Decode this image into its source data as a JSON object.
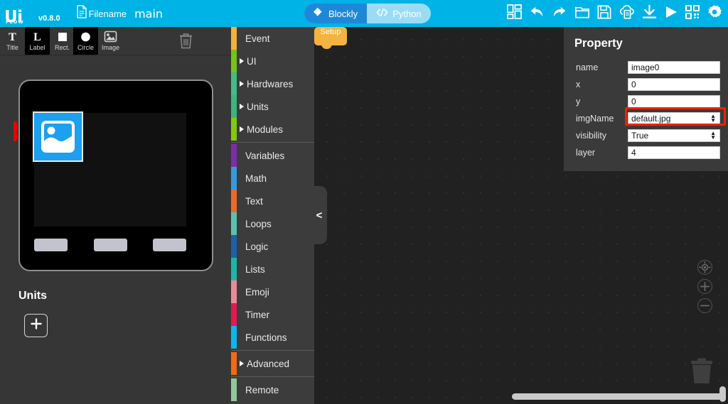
{
  "header": {
    "logo_main": "Ui",
    "logo_sub": "FLOW",
    "version": "v0.8.0",
    "filename_label": "Filename",
    "filename_value": "main",
    "doc_icon": "document-icon",
    "modes": [
      {
        "label": "Blockly",
        "icon": "puzzle-icon",
        "active": true
      },
      {
        "label": "Python",
        "icon": "code-icon",
        "active": false
      }
    ],
    "toolbar_icons": [
      "layout-blocks-icon",
      "undo-icon",
      "redo-icon",
      "open-folder-icon",
      "save-disk-icon",
      "cloud-file-icon",
      "download-icon",
      "run-play-icon",
      "qrcode-icon",
      "settings-gear-icon"
    ],
    "accent_color": "#00b3e6",
    "mode_active_color": "#1e88d8",
    "mode_track_color": "#9bdcf5"
  },
  "tools": {
    "items": [
      {
        "label": "Title",
        "icon": "title-T-icon",
        "selected": false
      },
      {
        "label": "Label",
        "icon": "label-L-icon",
        "selected": true
      },
      {
        "label": "Rect.",
        "icon": "rectangle-icon",
        "selected": false
      },
      {
        "label": "Circle",
        "icon": "circle-icon",
        "selected": true
      },
      {
        "label": "Image",
        "icon": "image-icon",
        "selected": false
      }
    ],
    "trash_icon": "trash-icon"
  },
  "device": {
    "screen_widget_icon": "image-placeholder-icon",
    "widget_color": "#1ca0f0",
    "side_button_color": "#ee0000",
    "buttons": 3
  },
  "units": {
    "title": "Units",
    "add_icon": "plus-icon"
  },
  "toolbox": {
    "categories": [
      {
        "label": "Event",
        "color": "#f2b23e",
        "expandable": false
      },
      {
        "label": "UI",
        "color": "#76c11a",
        "expandable": true
      },
      {
        "label": "Hardwares",
        "color": "#46b98a",
        "expandable": true
      },
      {
        "label": "Units",
        "color": "#3eb37e",
        "expandable": true
      },
      {
        "label": "Modules",
        "color": "#86c712",
        "expandable": true
      },
      {
        "separator": true
      },
      {
        "label": "Variables",
        "color": "#7a2fa8",
        "expandable": false
      },
      {
        "label": "Math",
        "color": "#3a9ad9",
        "expandable": false
      },
      {
        "label": "Text",
        "color": "#ea6a2a",
        "expandable": false
      },
      {
        "label": "Loops",
        "color": "#5fbfae",
        "expandable": false
      },
      {
        "label": "Logic",
        "color": "#1f5fa8",
        "expandable": false
      },
      {
        "label": "Lists",
        "color": "#1fb5a5",
        "expandable": false
      },
      {
        "label": "Emoji",
        "color": "#e98b97",
        "expandable": false
      },
      {
        "label": "Timer",
        "color": "#e01a52",
        "expandable": false
      },
      {
        "label": "Functions",
        "color": "#0fb6e8",
        "expandable": false
      },
      {
        "separator": true
      },
      {
        "label": "Advanced",
        "color": "#f06a18",
        "expandable": true
      },
      {
        "separator": true
      },
      {
        "label": "Remote",
        "color": "#93c79a",
        "expandable": false
      }
    ]
  },
  "workspace": {
    "setup_block_label": "Setup",
    "setup_block_color": "#f3b340",
    "collapse_icon": "<",
    "controls": [
      {
        "icon": "center-target-icon",
        "glyph": "⊙"
      },
      {
        "icon": "zoom-in-icon",
        "glyph": "+"
      },
      {
        "icon": "zoom-out-icon",
        "glyph": "−"
      }
    ],
    "trash_icon": "trash-icon"
  },
  "property": {
    "title": "Property",
    "rows": [
      {
        "label": "name",
        "value": "image0",
        "type": "text",
        "highlight": false
      },
      {
        "label": "x",
        "value": "0",
        "type": "text",
        "highlight": false
      },
      {
        "label": "y",
        "value": "0",
        "type": "text",
        "highlight": false
      },
      {
        "label": "imgName",
        "value": "default.jpg",
        "type": "select",
        "highlight": true
      },
      {
        "label": "visibility",
        "value": "True",
        "type": "select",
        "highlight": false
      },
      {
        "label": "layer",
        "value": "4",
        "type": "text",
        "highlight": false
      }
    ],
    "highlight_color": "#ee2200"
  }
}
